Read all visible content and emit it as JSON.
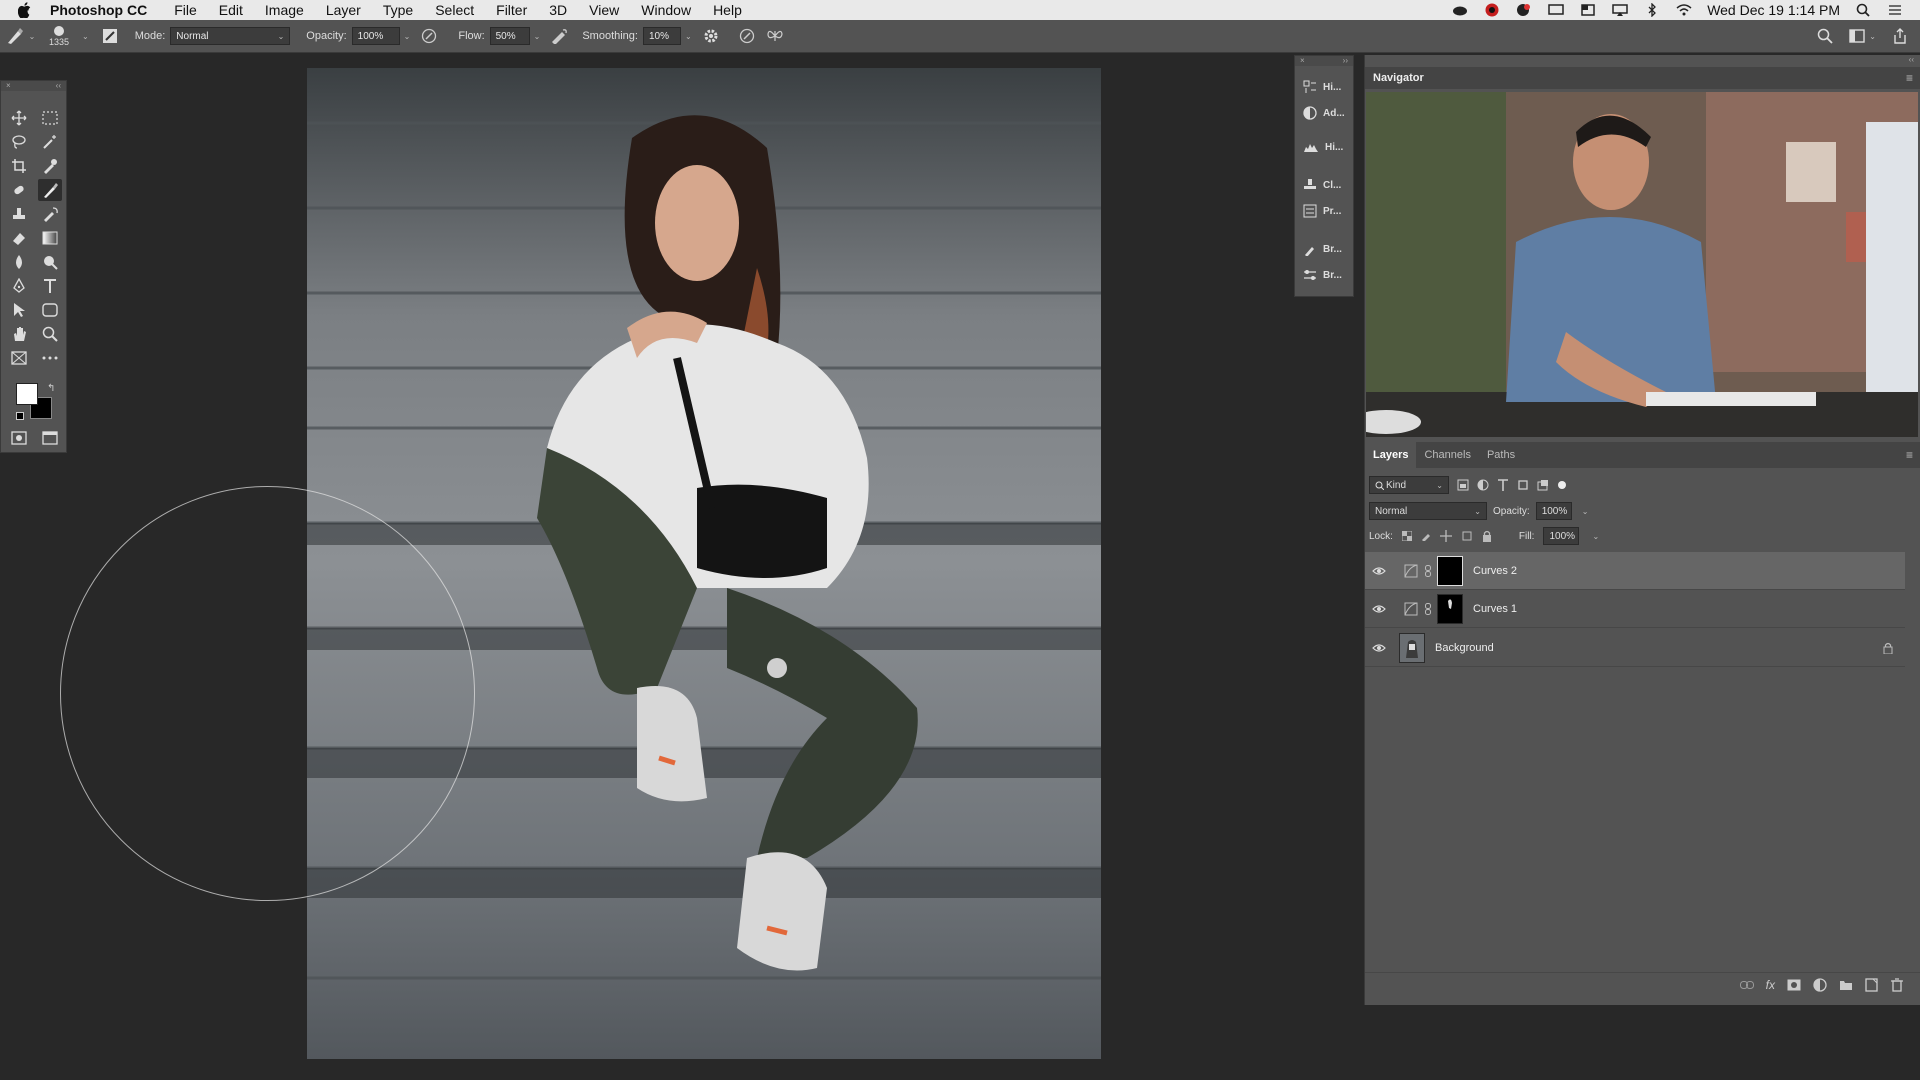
{
  "menubar": {
    "app_name": "Photoshop CC",
    "items": [
      "File",
      "Edit",
      "Image",
      "Layer",
      "Type",
      "Select",
      "Filter",
      "3D",
      "View",
      "Window",
      "Help"
    ],
    "clock": "Wed Dec 19  1:14 PM"
  },
  "options": {
    "brush_size": "1335",
    "mode_label": "Mode:",
    "mode_value": "Normal",
    "opacity_label": "Opacity:",
    "opacity_value": "100%",
    "flow_label": "Flow:",
    "flow_value": "50%",
    "smoothing_label": "Smoothing:",
    "smoothing_value": "10%"
  },
  "dock": {
    "items": [
      "Hi...",
      "Ad...",
      "Hi...",
      "Cl...",
      "Pr...",
      "Br...",
      "Br..."
    ]
  },
  "navigator": {
    "title": "Navigator"
  },
  "layers_panel": {
    "tabs": [
      "Layers",
      "Channels",
      "Paths"
    ],
    "kind_label": "Kind",
    "blend_mode": "Normal",
    "opacity_label": "Opacity:",
    "opacity_value": "100%",
    "lock_label": "Lock:",
    "fill_label": "Fill:",
    "fill_value": "100%",
    "layers": [
      {
        "name": "Curves 2"
      },
      {
        "name": "Curves 1"
      },
      {
        "name": "Background"
      }
    ]
  },
  "colors": {
    "menubar_bg": "#e9e9e9",
    "panel_bg": "#535353",
    "canvas_bg": "#282828",
    "selected_layer": "#666666"
  }
}
